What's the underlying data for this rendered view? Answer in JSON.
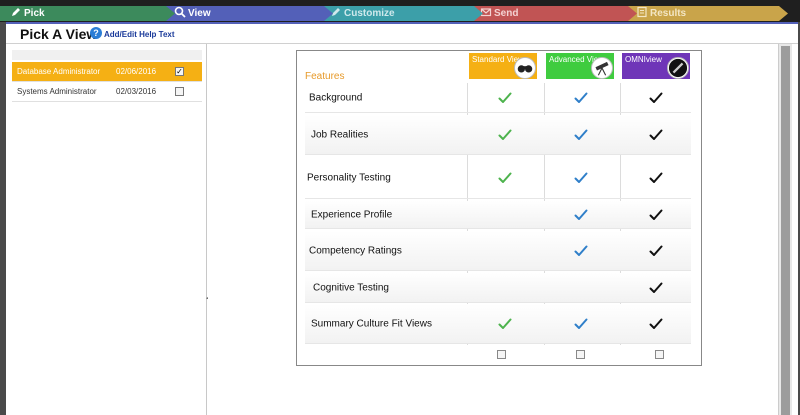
{
  "steps": [
    {
      "label": "Pick",
      "color": "#3c8a5c"
    },
    {
      "label": "View",
      "color": "#5360b8"
    },
    {
      "label": "Customize",
      "color": "#3c9fa9"
    },
    {
      "label": "Send",
      "color": "#c15454"
    },
    {
      "label": "Results",
      "color": "#c9a44a"
    }
  ],
  "header": {
    "title": "Pick A View",
    "help_link": "Add/Edit Help Text"
  },
  "list": {
    "items": [
      {
        "name": "Database Administrator",
        "date": "02/06/2016",
        "checked": true
      },
      {
        "name": "Systems Administrator",
        "date": "02/03/2016",
        "checked": false
      }
    ]
  },
  "compare": {
    "features_label": "Features",
    "views": [
      {
        "label": "Standard View",
        "color": "#f5b014",
        "icon": "binoculars-icon"
      },
      {
        "label": "Advanced View",
        "color": "#3fcc3f",
        "icon": "telescope-icon"
      },
      {
        "label": "OMNIview",
        "color": "#6f35b8",
        "icon": "microscope-icon"
      }
    ],
    "check_colors": {
      "standard": "#4db34d",
      "advanced": "#2f7fc9",
      "omni": "#111111"
    },
    "features": [
      {
        "name": "Background",
        "standard": true,
        "advanced": true,
        "omni": true
      },
      {
        "name": "Job Realities",
        "standard": true,
        "advanced": true,
        "omni": true
      },
      {
        "name": "Personality Testing",
        "standard": true,
        "advanced": true,
        "omni": true
      },
      {
        "name": "Experience Profile",
        "standard": false,
        "advanced": true,
        "omni": true
      },
      {
        "name": "Competency Ratings",
        "standard": false,
        "advanced": true,
        "omni": true
      },
      {
        "name": "Cognitive Testing",
        "standard": false,
        "advanced": false,
        "omni": true
      },
      {
        "name": "Summary Culture Fit Views",
        "standard": true,
        "advanced": true,
        "omni": true
      }
    ]
  }
}
